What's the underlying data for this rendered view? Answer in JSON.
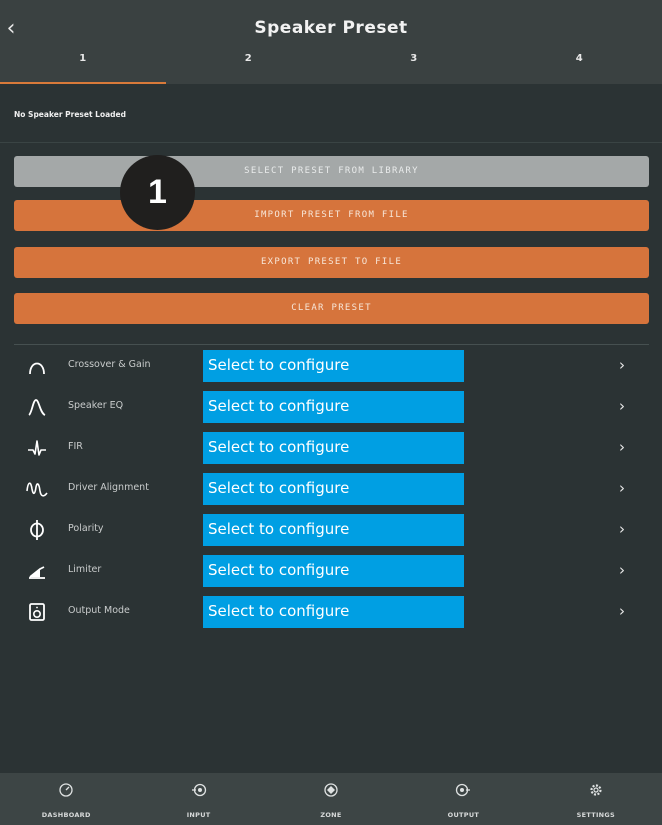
{
  "header": {
    "title": "Speaker Preset",
    "tabs": [
      {
        "label": "1",
        "active": true
      },
      {
        "label": "2",
        "active": false
      },
      {
        "label": "3",
        "active": false
      },
      {
        "label": "4",
        "active": false
      }
    ]
  },
  "status_text": "No Speaker Preset Loaded",
  "actions": {
    "select_library": "SELECT PRESET FROM LIBRARY",
    "import_file": "IMPORT PRESET FROM FILE",
    "export_file": "EXPORT PRESET TO FILE",
    "clear": "CLEAR PRESET"
  },
  "badge_number": "1",
  "rows": [
    {
      "label": "Crossover & Gain",
      "value": "Select to configure",
      "icon": "crossover-icon"
    },
    {
      "label": "Speaker EQ",
      "value": "Select to configure",
      "icon": "eq-curve-icon"
    },
    {
      "label": "FIR",
      "value": "Select to configure",
      "icon": "fir-waveform-icon"
    },
    {
      "label": "Driver Alignment",
      "value": "Select to configure",
      "icon": "driver-alignment-icon"
    },
    {
      "label": "Polarity",
      "value": "Select to configure",
      "icon": "polarity-icon"
    },
    {
      "label": "Limiter",
      "value": "Select to configure",
      "icon": "limiter-icon"
    },
    {
      "label": "Output Mode",
      "value": "Select to configure",
      "icon": "speaker-box-icon"
    }
  ],
  "bottom_nav": [
    {
      "label": "DASHBOARD",
      "icon": "dashboard-icon"
    },
    {
      "label": "INPUT",
      "icon": "input-icon"
    },
    {
      "label": "ZONE",
      "icon": "zone-icon"
    },
    {
      "label": "OUTPUT",
      "icon": "output-icon"
    },
    {
      "label": "SETTINGS",
      "icon": "gear-icon"
    }
  ],
  "colors": {
    "background": "#2b3334",
    "header": "#3a4141",
    "accent_orange": "#d6743c",
    "button_grey": "#a4a8a8",
    "value_highlight": "#009fe3"
  }
}
